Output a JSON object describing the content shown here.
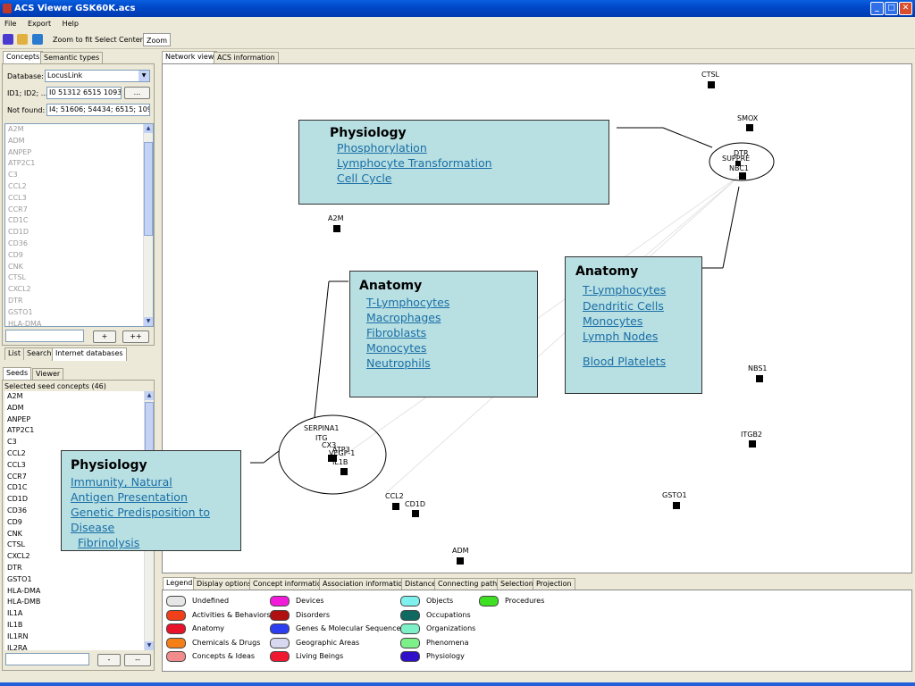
{
  "window": {
    "title": "ACS Viewer GSK60K.acs"
  },
  "menu": [
    "File",
    "Export",
    "Help"
  ],
  "toolbar": {
    "zoom_to_fit": "Zoom to fit",
    "select": "Select",
    "center": "Center",
    "zoom": "Zoom"
  },
  "left_top_tabs": [
    "Concepts",
    "Semantic types"
  ],
  "concepts": {
    "database_label": "Database:",
    "database_value": "LocusLink",
    "ids_label": "ID1; ID2; ...:",
    "ids_value": "I0 51312 6515 10938",
    "ids_button": "...",
    "notfound_label": "Not found:",
    "notfound_value": "I4; 51606; 54434; 6515; 10938",
    "list": [
      "A2M",
      "ADM",
      "ANPEP",
      "ATP2C1",
      "C3",
      "CCL2",
      "CCL3",
      "CCR7",
      "CD1C",
      "CD1D",
      "CD36",
      "CD9",
      "CNK",
      "CTSL",
      "CXCL2",
      "DTR",
      "GSTO1",
      "HLA-DMA"
    ],
    "add_button": "+",
    "add_all_button": "++"
  },
  "left_mid_tabs": [
    "List",
    "Search",
    "Internet databases"
  ],
  "seeds_tabs": [
    "Seeds",
    "Viewer"
  ],
  "seeds": {
    "header": "Selected seed concepts (46)",
    "list": [
      "A2M",
      "ADM",
      "ANPEP",
      "ATP2C1",
      "C3",
      "CCL2",
      "CCL3",
      "CCR7",
      "CD1C",
      "CD1D",
      "CD36",
      "CD9",
      "CNK",
      "CTSL",
      "CXCL2",
      "DTR",
      "GSTO1",
      "HLA-DMA",
      "HLA-DMB",
      "IL1A",
      "IL1B",
      "IL1RN",
      "IL2RA"
    ],
    "remove_button": "-",
    "remove_all_button": "--"
  },
  "view_tabs": [
    "Network view",
    "ACS information"
  ],
  "network": {
    "labels": {
      "ctsl": "CTSL",
      "smox": "SMOX",
      "dtr": "DTR",
      "suppress": "SUPPRE",
      "nbc1": "NBC1",
      "a2m": "A2M",
      "nbs1": "NBS1",
      "itgb2": "ITGB2",
      "gsto1": "GSTO1",
      "ccl2": "CCL2",
      "cd1d": "CD1D",
      "adm": "ADM",
      "serpina1": "SERPINA1",
      "cluster_mid": "ITG",
      "cluster_mid2": "VEGF-1",
      "il1b": "IL1B",
      "cluster_small1": "ATP3",
      "cluster_small2": "CX3"
    },
    "boxes": {
      "physiology_top": {
        "title": "Physiology",
        "links": [
          "Phosphorylation",
          "Lymphocyte Transformation",
          "Cell Cycle"
        ]
      },
      "anatomy_mid": {
        "title": "Anatomy",
        "links": [
          "T-Lymphocytes",
          "Macrophages",
          "Fibroblasts",
          "Monocytes",
          "Neutrophils"
        ]
      },
      "anatomy_right": {
        "title": "Anatomy",
        "links": [
          "T-Lymphocytes",
          "Dendritic Cells",
          "Monocytes",
          "Lymph Nodes",
          "Blood Platelets"
        ]
      },
      "physiology_left": {
        "title": "Physiology",
        "links": [
          "Immunity, Natural",
          "Antigen Presentation",
          "Genetic Predisposition to",
          "Disease",
          "Fibrinolysis"
        ]
      }
    }
  },
  "bottom_tabs": [
    "Legend",
    "Display options",
    "Concept information",
    "Association information",
    "Distance",
    "Connecting paths",
    "Selection",
    "Projection"
  ],
  "legend": [
    {
      "label": "Undefined",
      "color": "#e6e6e6"
    },
    {
      "label": "Activities & Behaviors",
      "color": "#f0401a"
    },
    {
      "label": "Anatomy",
      "color": "#e8122a"
    },
    {
      "label": "Chemicals & Drugs",
      "color": "#f57f17"
    },
    {
      "label": "Concepts & Ideas",
      "color": "#f28c8c"
    },
    {
      "label": "Devices",
      "color": "#f21bd9"
    },
    {
      "label": "Disorders",
      "color": "#b01010"
    },
    {
      "label": "Genes & Molecular Sequences",
      "color": "#2d3ef0"
    },
    {
      "label": "Geographic Areas",
      "color": "#d8d8f0"
    },
    {
      "label": "Living Beings",
      "color": "#f01830"
    },
    {
      "label": "Objects",
      "color": "#7ef0ee"
    },
    {
      "label": "Occupations",
      "color": "#0e6a60"
    },
    {
      "label": "Organizations",
      "color": "#7ef0c8"
    },
    {
      "label": "Phenomena",
      "color": "#7ef08a"
    },
    {
      "label": "Physiology",
      "color": "#3010c8"
    },
    {
      "label": "Procedures",
      "color": "#3ee021"
    }
  ]
}
